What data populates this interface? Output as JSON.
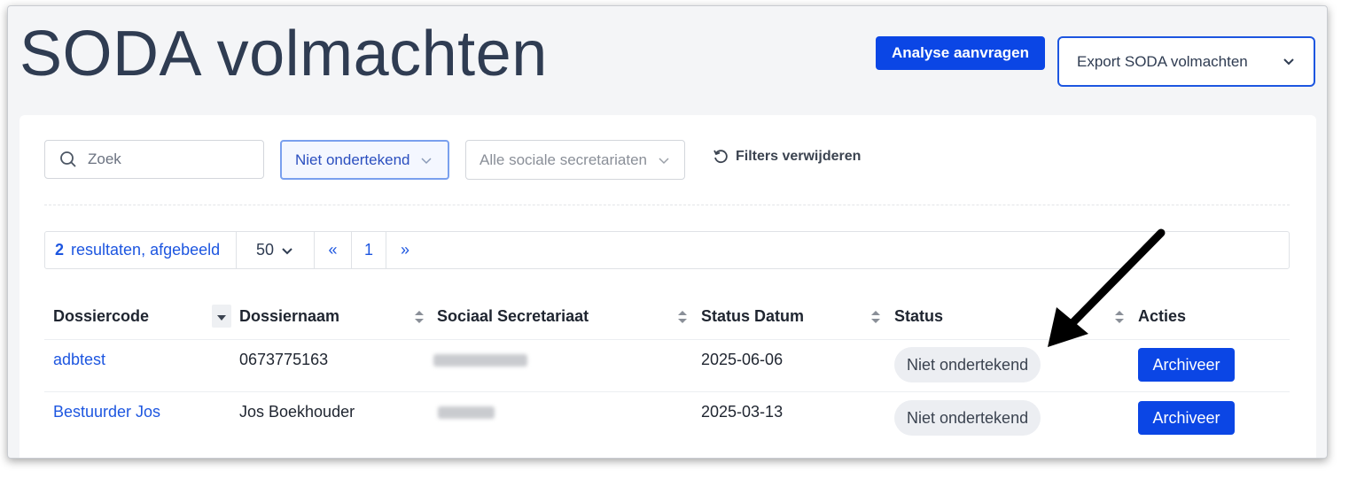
{
  "page": {
    "title": "SODA volmachten",
    "analyse_button": "Analyse aanvragen",
    "export_button": "Export SODA volmachten"
  },
  "filters": {
    "search_placeholder": "Zoek",
    "status_filter": "Niet ondertekend",
    "secretariat_filter": "Alle sociale secretariaten",
    "clear_label": "Filters verwijderen"
  },
  "pager": {
    "result_count": "2",
    "result_label": "resultaten, afgebeeld",
    "page_size": "50",
    "first": "«",
    "current_page": "1",
    "next": "»"
  },
  "table": {
    "columns": [
      "Dossiercode",
      "Dossiernaam",
      "Sociaal Secretariaat",
      "Status Datum",
      "Status",
      "Acties"
    ],
    "rows": [
      {
        "code": "adbtest",
        "name": "0673775163",
        "date": "2025-06-06",
        "status": "Niet ondertekend",
        "action": "Archiveer"
      },
      {
        "code": "Bestuurder Jos",
        "name": "Jos Boekhouder",
        "date": "2025-03-13",
        "status": "Niet ondertekend",
        "action": "Archiveer"
      }
    ]
  },
  "colors": {
    "primary": "#0b46e5",
    "title": "#2f3c52",
    "link": "#1d56e0"
  }
}
